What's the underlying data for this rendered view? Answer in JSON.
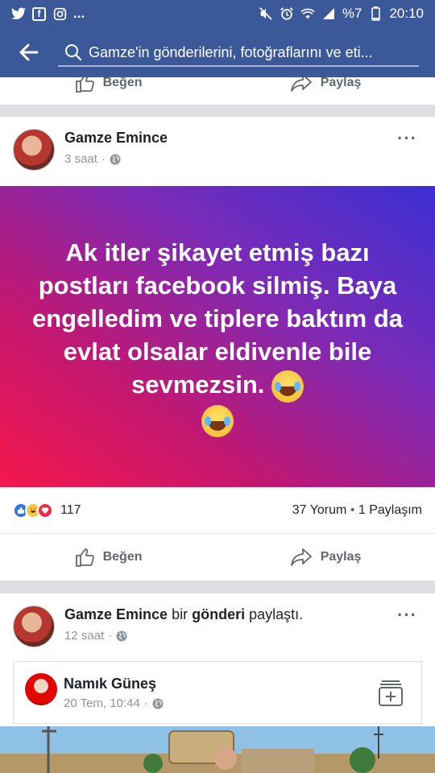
{
  "status_bar": {
    "left_icons": [
      "twitter-icon",
      "facebook-icon",
      "instagram-icon"
    ],
    "more": "...",
    "battery": "%7",
    "time": "20:10"
  },
  "search": {
    "placeholder": "Gamze'in gönderilerini, fotoğraflarını ve eti..."
  },
  "top_actions": {
    "like": "Beğen",
    "share": "Paylaş"
  },
  "post1": {
    "author": "Gamze Emince",
    "time": "3 saat",
    "text": "Ak itler şikayet etmiş bazı postları facebook silmiş. Baya engelledim ve tiplere baktım da evlat olsalar eldivenle bile sevmezsin.",
    "reaction_count": "117",
    "comments": "37 Yorum",
    "shares": "1 Paylaşım",
    "like": "Beğen",
    "share": "Paylaş",
    "more": "···"
  },
  "post2": {
    "author": "Gamze Emince",
    "verb_pre": "bir",
    "verb_obj": "gönderi",
    "verb_post": "paylaştı.",
    "time": "12 saat",
    "more": "···",
    "shared": {
      "author": "Namık Güneş",
      "time": "20 Tem, 10:44"
    }
  },
  "colors": {
    "brand": "#3b5998",
    "gradient_start": "#f5174c",
    "gradient_end": "#3b2fd2"
  }
}
